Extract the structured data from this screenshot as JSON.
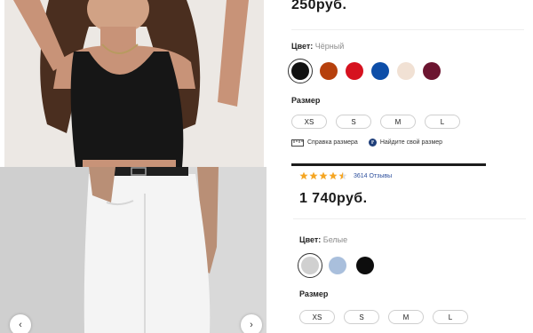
{
  "top": {
    "price": "250руб.",
    "color_label": "Цвет:",
    "color_value": "Чёрный",
    "colors": [
      "#111111",
      "#b6400d",
      "#d6121f",
      "#0d4ea8",
      "#f1e1d4",
      "#6c1530"
    ],
    "size_label": "Размер",
    "sizes": [
      "XS",
      "S",
      "M",
      "L"
    ],
    "size_guide_label": "Справка размера",
    "find_size_label": "Найдите свой размер"
  },
  "bottom": {
    "rating": 4.5,
    "reviews_label": "3614 Отзывы",
    "price": "1 740руб.",
    "color_label": "Цвет:",
    "color_value": "Белые",
    "colors": [
      "#d0d0d0",
      "#a9bfdc",
      "#0d0d0d"
    ],
    "size_label": "Размер",
    "sizes": [
      "XS",
      "S",
      "M",
      "L"
    ]
  },
  "icons": {
    "size_guide": "ruler-icon",
    "find_size": "size-finder-icon",
    "prev": "chevron-left-icon",
    "next": "chevron-right-icon",
    "star": "star-icon"
  },
  "nav": {
    "prev_glyph": "‹",
    "next_glyph": "›"
  }
}
